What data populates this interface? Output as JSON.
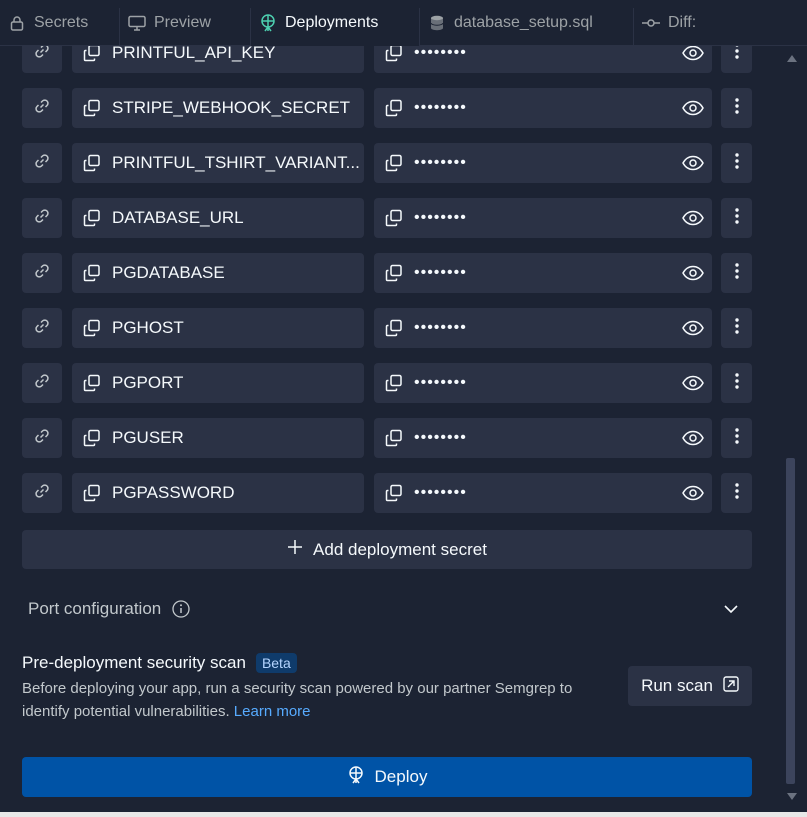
{
  "tabs": [
    {
      "label": "Secrets",
      "icon": "lock-icon",
      "active": false
    },
    {
      "label": "Preview",
      "icon": "monitor-icon",
      "active": false
    },
    {
      "label": "Deployments",
      "icon": "deploy-icon",
      "active": true
    },
    {
      "label": "database_setup.sql",
      "icon": "database-icon",
      "active": false
    },
    {
      "label": "Diff:",
      "icon": "git-commit-icon",
      "active": false
    }
  ],
  "secrets": [
    {
      "key": "PRINTFUL_API_KEY",
      "value": "••••••••"
    },
    {
      "key": "STRIPE_WEBHOOK_SECRET",
      "value": "••••••••"
    },
    {
      "key": "PRINTFUL_TSHIRT_VARIANT...",
      "value": "••••••••"
    },
    {
      "key": "DATABASE_URL",
      "value": "••••••••"
    },
    {
      "key": "PGDATABASE",
      "value": "••••••••"
    },
    {
      "key": "PGHOST",
      "value": "••••••••"
    },
    {
      "key": "PGPORT",
      "value": "••••••••"
    },
    {
      "key": "PGUSER",
      "value": "••••••••"
    },
    {
      "key": "PGPASSWORD",
      "value": "••••••••"
    }
  ],
  "add_secret_label": "Add deployment secret",
  "port_config": {
    "label": "Port configuration"
  },
  "security_scan": {
    "title": "Pre-deployment security scan",
    "badge": "Beta",
    "description": "Before deploying your app, run a security scan powered by our partner Semgrep to identify potential vulnerabilities.",
    "learn_more": "Learn more",
    "run_scan_label": "Run scan"
  },
  "deploy_label": "Deploy",
  "colors": {
    "background": "#1c2333",
    "field": "#2b3245",
    "primary": "#0053a6",
    "link": "#57abff",
    "badge_bg": "#0f3b6b"
  }
}
